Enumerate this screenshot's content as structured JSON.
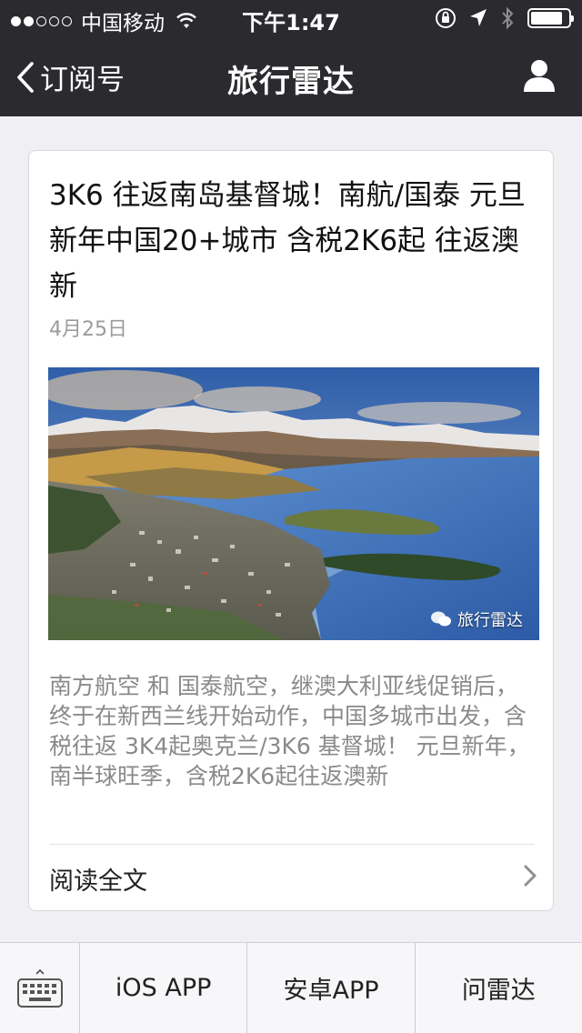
{
  "status_bar": {
    "carrier": "中国移动",
    "time": "下午1:47",
    "battery_level": 0.85
  },
  "nav": {
    "back_label": "订阅号",
    "title": "旅行雷达"
  },
  "article": {
    "title": "3K6 往返南岛基督城！南航/国泰 元旦新年中国20+城市 含税2K6起 往返澳新",
    "date": "4月25日",
    "watermark": "旅行雷达",
    "summary": "南方航空 和 国泰航空，继澳大利亚线促销后，终于在新西兰线开始动作，中国多城市出发，含税往返 3K4起奥克兰/3K6 基督城！ 元旦新年，南半球旺季，含税2K6起往返澳新",
    "read_more": "阅读全文"
  },
  "bottom_menu": {
    "items": [
      "iOS APP",
      "安卓APP",
      "问雷达"
    ]
  },
  "colors": {
    "bar_bg": "#2b2b2f",
    "page_bg": "#efeff4",
    "summary_text": "#8a8a8a"
  }
}
